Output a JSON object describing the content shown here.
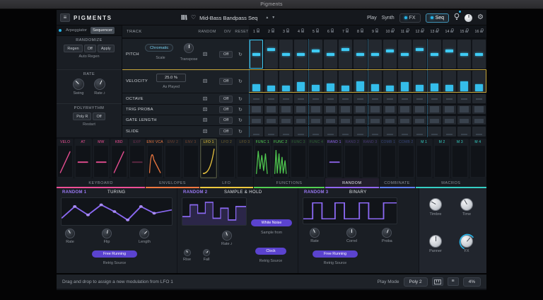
{
  "window": {
    "title": "Pigments"
  },
  "header": {
    "logo": "PIGMENTS",
    "preset_name": "Mid-Bass Bandpass Seq",
    "play_label": "Play",
    "synth_label": "Synth",
    "fx_label": "FX",
    "seq_label": "Seq"
  },
  "left_panel": {
    "tab_arpeggiator": "Arpeggiator",
    "tab_sequencer": "Sequencer",
    "randomize_title": "RANDOMIZE",
    "regen_label": "Regen",
    "randomize_off_label": "Off",
    "apply_label": "Apply",
    "auto_regen_label": "Auto Regen",
    "rate_title": "RATE",
    "swing_label": "Swing",
    "rate_label": "Rate",
    "polyrhythm_title": "POLYRHYTHM",
    "poly_r_label": "Poly R",
    "poly_off_label": "Off",
    "restart_label": "Restart"
  },
  "sequencer": {
    "track_label": "TRACK",
    "random_col_label": "RANDOM",
    "div_col_label": "DIV",
    "reset_col_label": "RESET",
    "steps": [
      "1",
      "2",
      "3",
      "4",
      "5",
      "6",
      "7",
      "8",
      "9",
      "10",
      "11",
      "12",
      "13",
      "14",
      "15",
      "16"
    ],
    "rows": [
      {
        "label": "PITCH",
        "mode": "Chromatic",
        "scale_label": "Scale",
        "transpose_label": "Transpose",
        "off_label": "Off",
        "type": "pitch",
        "values": [
          0.5,
          0.34,
          0.52,
          0.5,
          0.4,
          0.52,
          0.34,
          0.5,
          0.52,
          0.4,
          0.5,
          0.34,
          0.52,
          0.4,
          0.5,
          0.52
        ]
      },
      {
        "label": "VELOCITY",
        "value": "25.0 %",
        "sub_label": "As Played",
        "off_label": "Off",
        "type": "vel",
        "values": [
          0.32,
          0.28,
          0.26,
          0.42,
          0.3,
          0.36,
          0.28,
          0.46,
          0.32,
          0.28,
          0.44,
          0.3,
          0.38,
          0.3,
          0.46,
          0.34
        ]
      },
      {
        "label": "OCTAVE",
        "off_label": "Off",
        "type": "dash",
        "values": [
          0.5,
          0.5,
          0.5,
          0.5,
          0.5,
          0.5,
          0.5,
          0.5,
          0.5,
          0.5,
          0.5,
          0.5,
          0.5,
          0.5,
          0.5,
          0.5
        ]
      },
      {
        "label": "TRIG PROBA",
        "off_label": "Off",
        "type": "bar",
        "values": [
          0.72,
          0.72,
          0.72,
          0.72,
          0.72,
          0.72,
          0.72,
          0.72,
          0.72,
          0.72,
          0.72,
          0.72,
          0.72,
          0.72,
          0.72,
          0.72
        ]
      },
      {
        "label": "GATE LENGTH",
        "off_label": "Off",
        "type": "bar",
        "values": [
          0.5,
          0.5,
          0.5,
          0.5,
          0.5,
          0.5,
          0.5,
          0.5,
          0.5,
          0.5,
          0.5,
          0.5,
          0.5,
          0.5,
          0.5,
          0.5
        ]
      },
      {
        "label": "SLIDE",
        "off_label": "Off",
        "type": "tick",
        "values": [
          0.1,
          0.1,
          0.1,
          0.1,
          0.1,
          0.1,
          0.1,
          0.1,
          0.1,
          0.1,
          0.1,
          0.1,
          0.1,
          0.1,
          0.1,
          0.1
        ]
      }
    ]
  },
  "mod_strip": {
    "group_colors": {
      "kbd": "#ef4f96",
      "env": "#f07840",
      "lfo": "#efc93f",
      "func": "#52cf52",
      "rand": "#9166f2",
      "comb": "#5f7df2",
      "macro": "#34cfc4"
    },
    "slots": [
      {
        "label": "VELO",
        "group": "kbd",
        "shape": "ramp",
        "bright": true
      },
      {
        "label": "AT",
        "group": "kbd",
        "shape": "flat",
        "bright": true
      },
      {
        "label": "MW",
        "group": "kbd",
        "shape": "flat",
        "bright": true
      },
      {
        "label": "KBD",
        "group": "kbd",
        "shape": "ramp",
        "bright": true
      },
      {
        "label": "EXP",
        "group": "kbd",
        "shape": "flat",
        "bright": false
      },
      {
        "label": "ENV VCA",
        "group": "env",
        "shape": "env",
        "bright": true
      },
      {
        "label": "ENV 2",
        "group": "env",
        "shape": "none",
        "bright": false
      },
      {
        "label": "ENV 3",
        "group": "env",
        "shape": "none",
        "bright": false
      },
      {
        "label": "LFO 1",
        "group": "lfo",
        "shape": "lfo",
        "bright": true,
        "selected": true
      },
      {
        "label": "LFO 2",
        "group": "lfo",
        "shape": "none",
        "bright": false
      },
      {
        "label": "LFO 3",
        "group": "lfo",
        "shape": "none",
        "bright": false
      },
      {
        "label": "FUNC 1",
        "group": "func",
        "shape": "func1",
        "bright": true
      },
      {
        "label": "FUNC 2",
        "group": "func",
        "shape": "func2",
        "bright": true
      },
      {
        "label": "FUNC 3",
        "group": "func",
        "shape": "none",
        "bright": false
      },
      {
        "label": "FUNC 4",
        "group": "func",
        "shape": "none",
        "bright": false
      },
      {
        "label": "RAND 1",
        "group": "rand",
        "shape": "flat",
        "bright": true
      },
      {
        "label": "RAND 2",
        "group": "rand",
        "shape": "none",
        "bright": false
      },
      {
        "label": "RAND 3",
        "group": "rand",
        "shape": "none",
        "bright": false
      },
      {
        "label": "COMB 1",
        "group": "comb",
        "shape": "none",
        "bright": false
      },
      {
        "label": "COMB 2",
        "group": "comb",
        "shape": "none",
        "bright": false
      },
      {
        "label": "M 1",
        "group": "macro",
        "shape": "none",
        "bright": true
      },
      {
        "label": "M 2",
        "group": "macro",
        "shape": "none",
        "bright": true
      },
      {
        "label": "M 3",
        "group": "macro",
        "shape": "none",
        "bright": true
      },
      {
        "label": "M 4",
        "group": "macro",
        "shape": "none",
        "bright": true
      }
    ],
    "groups": [
      {
        "label": "KEYBOARD",
        "span": 5,
        "color": "#ef4f96"
      },
      {
        "label": "ENVELOPES",
        "span": 3,
        "color": "#f07840"
      },
      {
        "label": "LFO",
        "span": 3,
        "color": "#efc93f"
      },
      {
        "label": "FUNCTIONS",
        "span": 4,
        "color": "#52cf52"
      },
      {
        "label": "RANDOM",
        "span": 3,
        "color": "#9166f2",
        "selected": true
      },
      {
        "label": "COMBINATE",
        "span": 2,
        "color": "#5f7df2"
      },
      {
        "label": "MACROS",
        "span": 4,
        "color": "#34cfc4"
      }
    ]
  },
  "random1": {
    "title": "RANDOM 1",
    "mode": "TURING",
    "rate_label": "Rate",
    "flip_label": "Flip",
    "length_label": "Length",
    "free_running_label": "Free Running",
    "retrig_label": "Retrig Source"
  },
  "random2": {
    "title": "RANDOM 2",
    "mode": "SAMPLE & HOLD",
    "white_noise_label": "White Noise",
    "sample_from_label": "Sample from",
    "rate_label": "Rate",
    "rise_label": "Rise",
    "fall_label": "Fall",
    "clock_label": "Clock",
    "retrig_label": "Retrig Source"
  },
  "random3": {
    "title": "RANDOM 3",
    "mode": "BINARY",
    "rate_label": "Rate",
    "correl_label": "Correl",
    "proba_label": "Proba",
    "free_running_label": "Free Running",
    "retrig_label": "Retrig Source"
  },
  "macros": {
    "timbre_label": "Timbre",
    "time_label": "Time",
    "panner_label": "Panner",
    "fx_label": "FX"
  },
  "status_bar": {
    "hint": "Drag and drop to assign a new modulation from LFO 1",
    "play_mode_label": "Play Mode",
    "play_mode_value": "Poly 2",
    "cpu": "4%"
  }
}
